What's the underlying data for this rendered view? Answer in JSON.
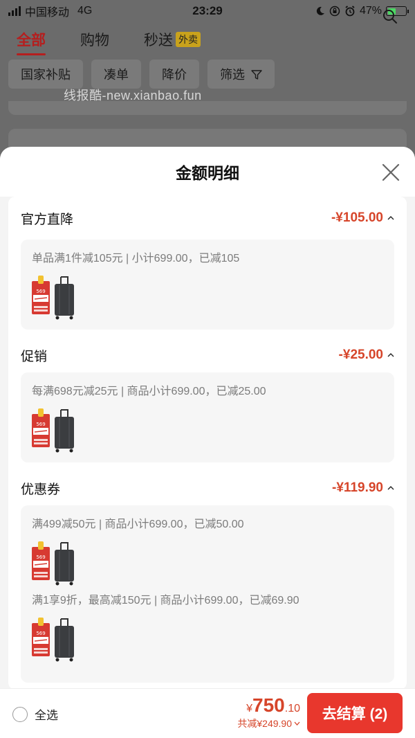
{
  "status_bar": {
    "carrier": "中国移动",
    "network": "4G",
    "time": "23:29",
    "battery": "47%",
    "battery_level": 0.47
  },
  "nav": {
    "tabs": [
      {
        "label": "全部",
        "active": true
      },
      {
        "label": "购物",
        "active": false
      },
      {
        "label": "秒送",
        "active": false,
        "badge": "外卖"
      }
    ]
  },
  "filters": [
    "国家补贴",
    "凑单",
    "降价",
    "筛选"
  ],
  "watermark": "线报酷-new.xianbao.fun",
  "sheet": {
    "title": "金额明细",
    "sections": [
      {
        "title": "官方直降",
        "amount": "-¥105.00",
        "items": [
          {
            "text": "单品满1件减105元 | 小计699.00，已减105"
          }
        ]
      },
      {
        "title": "促销",
        "amount": "-¥25.00",
        "items": [
          {
            "text": "每满698元减25元 | 商品小计699.00，已减25.00"
          }
        ]
      },
      {
        "title": "优惠券",
        "amount": "-¥119.90",
        "items": [
          {
            "text": "满499减50元 | 商品小计699.00，已减50.00"
          },
          {
            "text": "满1享9折，最高减150元 | 商品小计699.00，已减69.90"
          }
        ]
      }
    ],
    "gift_label": "569"
  },
  "bottom": {
    "select_all": "全选",
    "yen": "¥",
    "total_int": "750",
    "total_dec": ".10",
    "saved": "共减¥249.90",
    "checkout": "去结算 (2)"
  },
  "colors": {
    "accent_red": "#e8372d",
    "price_red": "#d6452a",
    "nav_active": "#b51e1e"
  }
}
